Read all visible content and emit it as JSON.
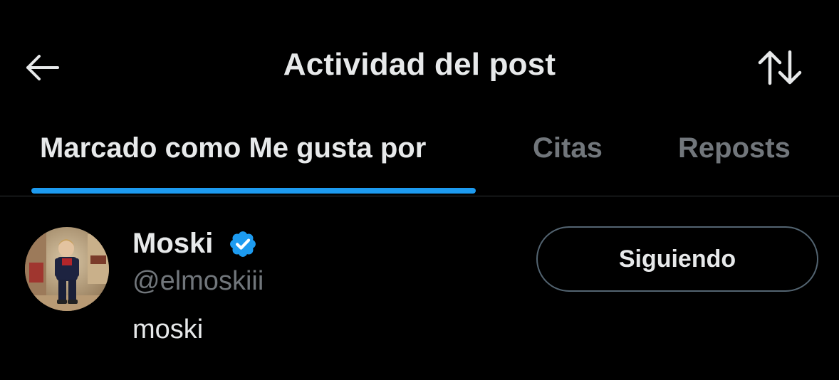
{
  "header": {
    "title": "Actividad del post",
    "back_icon": "arrow-left-icon",
    "sort_icon": "sort-arrows-icon"
  },
  "tabs": [
    {
      "label": "Marcado como Me gusta por",
      "active": true
    },
    {
      "label": "Citas",
      "active": false
    },
    {
      "label": "Reposts",
      "active": false
    }
  ],
  "users": [
    {
      "display_name": "Moski",
      "verified": true,
      "handle": "@elmoskiii",
      "bio": "moski",
      "follow_label": "Siguiendo"
    }
  ],
  "colors": {
    "background": "#000000",
    "text_primary": "#e7e9ea",
    "text_secondary": "#71767b",
    "accent": "#1d9bf0",
    "divider": "#2f3336",
    "button_border": "#536471"
  }
}
